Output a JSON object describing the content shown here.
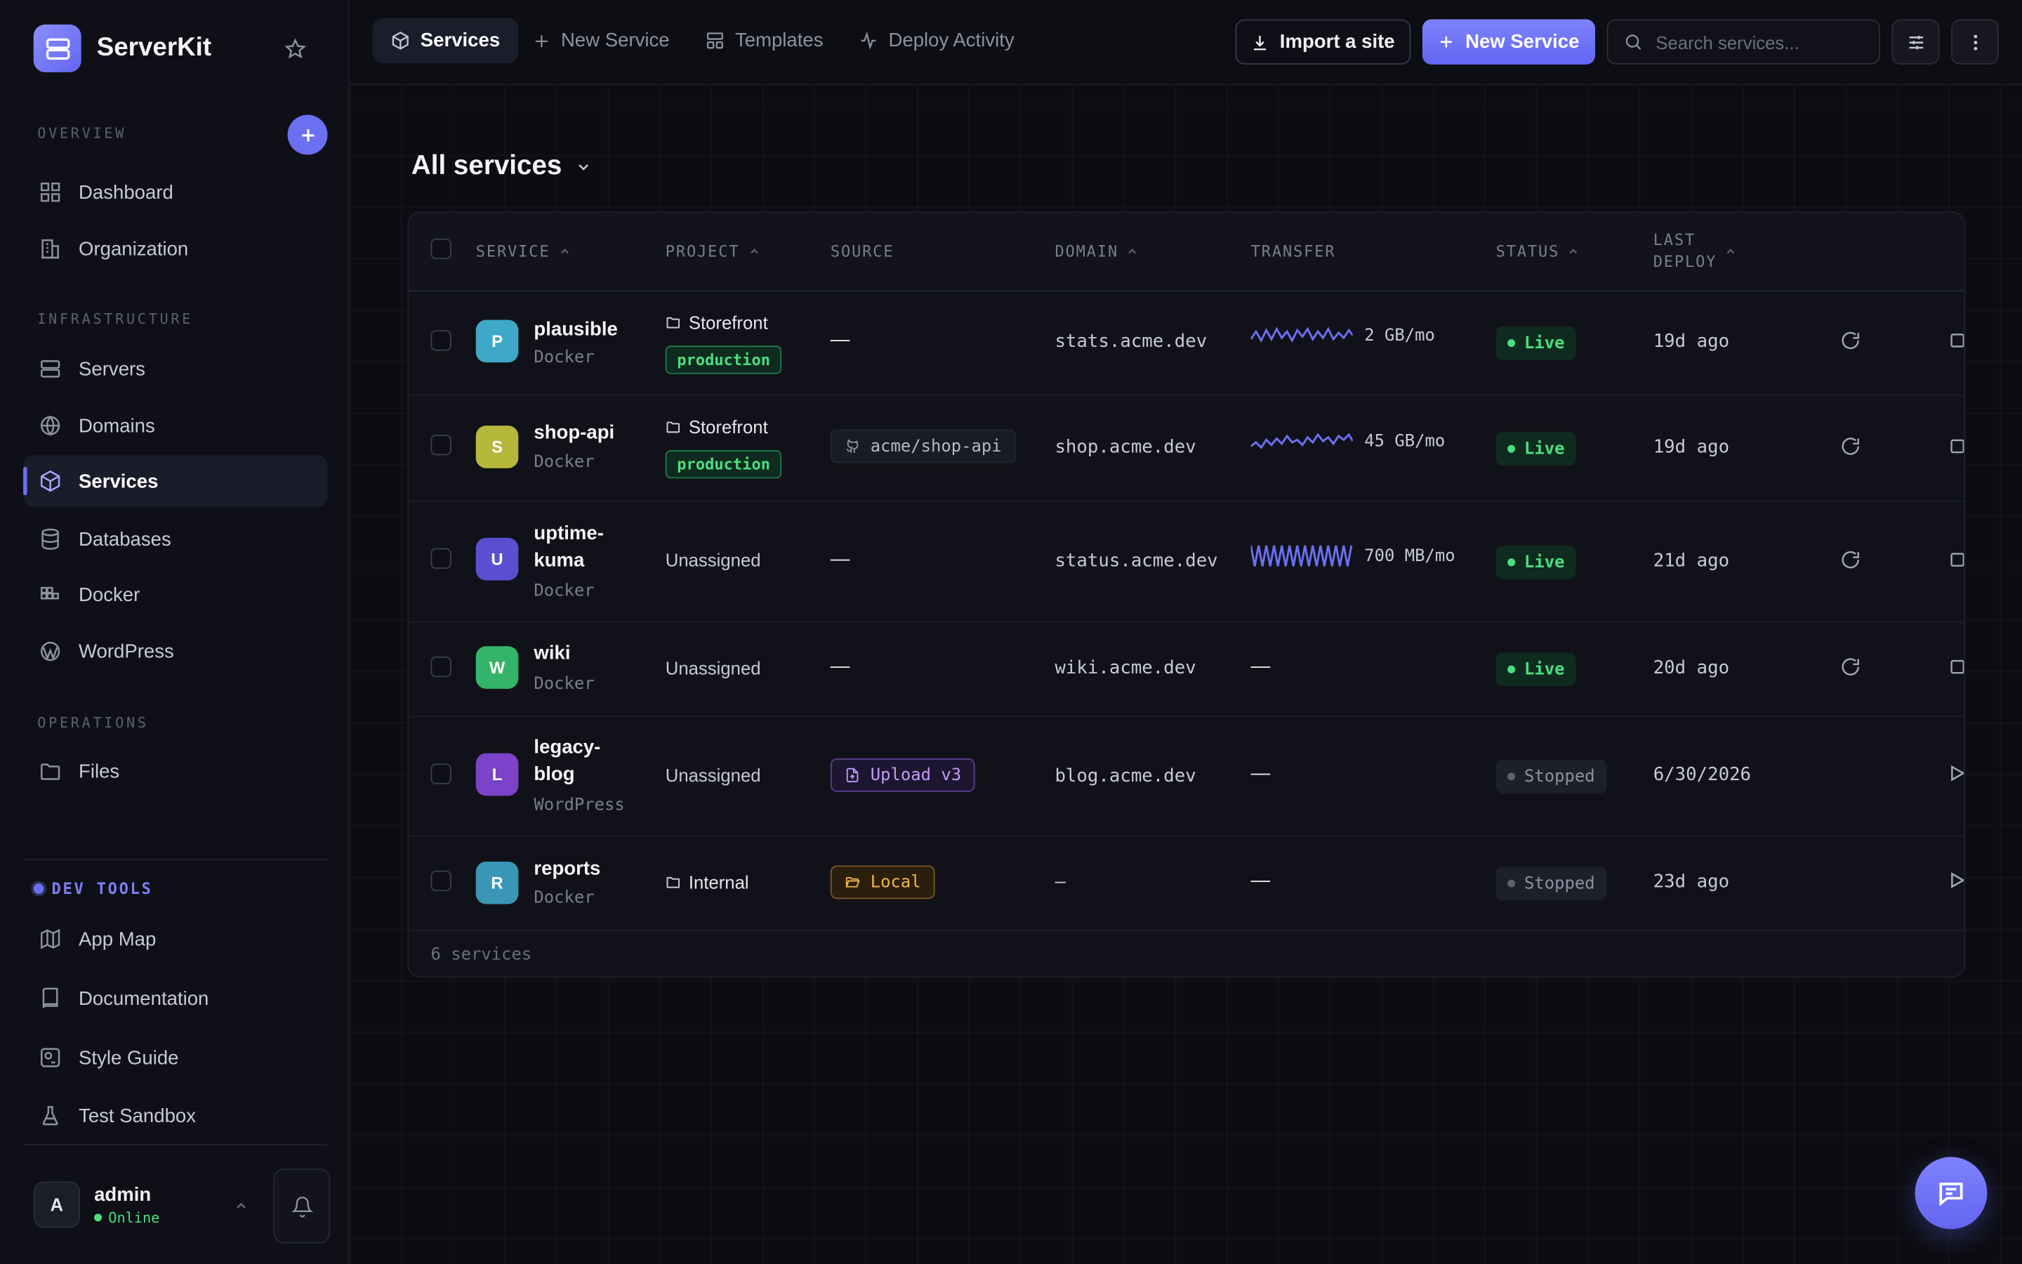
{
  "sidebar": {
    "brand": "ServerKit",
    "sections": {
      "overview": "OVERVIEW",
      "infrastructure": "INFRASTRUCTURE",
      "operations": "OPERATIONS",
      "devtools": "DEV TOOLS"
    },
    "items": {
      "dashboard": "Dashboard",
      "organization": "Organization",
      "servers": "Servers",
      "domains": "Domains",
      "services": "Services",
      "databases": "Databases",
      "docker": "Docker",
      "wordpress": "WordPress",
      "files": "Files",
      "app_map": "App Map",
      "documentation": "Documentation",
      "style_guide": "Style Guide",
      "test_sandbox": "Test Sandbox"
    },
    "active_item": "Services",
    "user": {
      "initial": "A",
      "name": "admin",
      "status": "Online"
    }
  },
  "topbar": {
    "tabs": [
      "Services",
      "New Service",
      "Templates",
      "Deploy Activity"
    ],
    "active_tab": "Services",
    "import_label": "Import a site",
    "new_service_label": "New Service",
    "search_placeholder": "Search services..."
  },
  "page": {
    "title": "All services"
  },
  "table": {
    "columns": {
      "service": "SERVICE",
      "project": "PROJECT",
      "source": "SOURCE",
      "domain": "DOMAIN",
      "transfer": "TRANSFER",
      "status": "STATUS",
      "last_deploy_1": "LAST",
      "last_deploy_2": "DEPLOY"
    },
    "rows": [
      {
        "initial": "P",
        "name": "plausible",
        "name_line2": "",
        "type": "Docker",
        "project": "Storefront",
        "env": "production",
        "source": "—",
        "domain": "stats.acme.dev",
        "transfer": "2 GB/mo",
        "status": "Live",
        "last_deploy": "19d ago"
      },
      {
        "initial": "S",
        "name": "shop-api",
        "name_line2": "",
        "type": "Docker",
        "project": "Storefront",
        "env": "production",
        "source": "acme/shop-api",
        "domain": "shop.acme.dev",
        "transfer": "45 GB/mo",
        "status": "Live",
        "last_deploy": "19d ago"
      },
      {
        "initial": "U",
        "name": "uptime-",
        "name_line2": "kuma",
        "type": "Docker",
        "project": "Unassigned",
        "env": "",
        "source": "—",
        "domain": "status.acme.dev",
        "transfer": "700 MB/mo",
        "status": "Live",
        "last_deploy": "21d ago"
      },
      {
        "initial": "W",
        "name": "wiki",
        "name_line2": "",
        "type": "Docker",
        "project": "Unassigned",
        "env": "",
        "source": "—",
        "domain": "wiki.acme.dev",
        "transfer": "—",
        "status": "Live",
        "last_deploy": "20d ago"
      },
      {
        "initial": "L",
        "name": "legacy-",
        "name_line2": "blog",
        "type": "WordPress",
        "project": "Unassigned",
        "env": "",
        "source": "Upload v3",
        "domain": "blog.acme.dev",
        "transfer": "—",
        "status": "Stopped",
        "last_deploy": "6/30/2026"
      },
      {
        "initial": "R",
        "name": "reports",
        "name_line2": "",
        "type": "Docker",
        "project": "Internal",
        "env": "",
        "source": "Local",
        "domain": "–",
        "transfer": "—",
        "status": "Stopped",
        "last_deploy": "23d ago"
      }
    ],
    "footer": "6 services"
  },
  "colors": {
    "accent": "#6b6ff2",
    "live": "#4ade80",
    "avatar_p": "#3fa8c8",
    "avatar_s": "#b5b83a",
    "avatar_u": "#5b4fd1",
    "avatar_w": "#34b46a",
    "avatar_l": "#7c43c9",
    "avatar_r": "#3a96b5"
  }
}
